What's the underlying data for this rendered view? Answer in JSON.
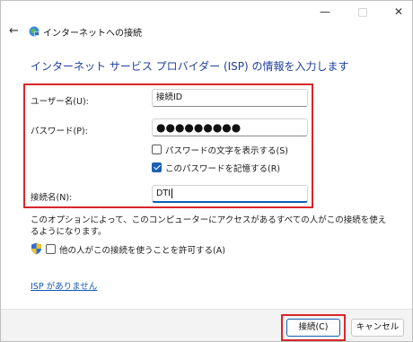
{
  "window": {
    "nav_title": "インターネットへの接続",
    "controls": {
      "minimize": "—",
      "maximize": "□",
      "close": "✕"
    }
  },
  "heading": "インターネット サービス プロバイダー (ISP) の情報を入力します",
  "form": {
    "username_label": "ユーザー名(U):",
    "username_value": "接続ID",
    "password_label": "パスワード(P):",
    "password_value": "●●●●●●●●●",
    "show_password_label": "パスワードの文字を表示する(S)",
    "show_password_checked": false,
    "remember_password_label": "このパスワードを記憶する(R)",
    "remember_password_checked": true,
    "connection_name_label": "接続名(N):",
    "connection_name_value": "DTI"
  },
  "note": "このオプションによって、このコンピューターにアクセスがあるすべての人がこの接続を使えるようになります。",
  "allow_others_label": "他の人がこの接続を使うことを許可する(A)",
  "allow_others_checked": false,
  "no_isp_link": "ISP がありません",
  "buttons": {
    "connect": "接続(C)",
    "cancel": "キャンセル"
  },
  "colors": {
    "accent": "#1a5fb4",
    "highlight": "#d9262b",
    "heading": "#1f3f9e"
  },
  "icons": {
    "back": "back-arrow-icon",
    "globe": "network-globe-icon",
    "shield": "uac-shield-icon"
  }
}
